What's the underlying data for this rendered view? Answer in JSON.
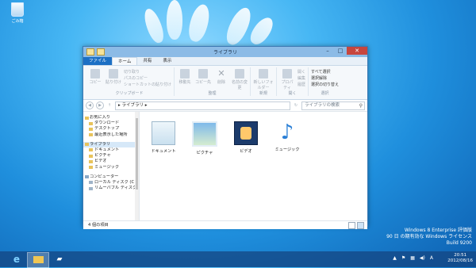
{
  "desktop": {
    "recycle_bin_label": "ごみ箱",
    "watermark": [
      "Windows 8 Enterprise 評価版",
      "90 日 の期有効な Windows ライセンス",
      "Build 9200"
    ]
  },
  "window": {
    "title": "ライブラリ",
    "tabs": [
      {
        "label": "ファイル"
      },
      {
        "label": "ホーム"
      },
      {
        "label": "共有"
      },
      {
        "label": "表示"
      }
    ],
    "ribbon": {
      "clipboard": {
        "copy": "コピー",
        "paste": "貼り付け",
        "cut": "切り取り",
        "copy_path": "パスのコピー",
        "paste_shortcut": "ショートカットの貼り付け",
        "group_label": "クリップボード"
      },
      "organize": {
        "move_to": "移動先",
        "copy_to": "コピー先",
        "delete": "削除",
        "rename": "名前の変更",
        "group_label": "整理"
      },
      "new": {
        "new_folder": "新しいフォルダー",
        "group_label": "新規"
      },
      "open": {
        "properties": "プロパティ",
        "open": "開く",
        "edit": "編集",
        "history": "履歴",
        "group_label": "開く"
      },
      "select": {
        "select_all": "すべて選択",
        "select_none": "選択解除",
        "invert": "選択の切り替え",
        "group_label": "選択"
      }
    },
    "address": {
      "path": "ライブラリ",
      "search_placeholder": "ライブラリの検索"
    },
    "nav_pane": {
      "favorites": "お気に入り",
      "favorites_items": [
        "ダウンロード",
        "デスクトップ",
        "最近表示した場所"
      ],
      "libraries": "ライブラリ",
      "libraries_items": [
        "ドキュメント",
        "ピクチャ",
        "ビデオ",
        "ミュージック"
      ],
      "computer": "コンピューター",
      "computer_items": [
        "ローカル ディスク (C",
        "リムーバブル ディスク"
      ]
    },
    "libraries": [
      {
        "label": "ドキュメント"
      },
      {
        "label": "ピクチャ"
      },
      {
        "label": "ビデオ"
      },
      {
        "label": "ミュージック"
      }
    ],
    "status": "4 個の項目"
  },
  "taskbar": {
    "time": "20:51",
    "date": "2012/08/16",
    "ime": "A"
  }
}
